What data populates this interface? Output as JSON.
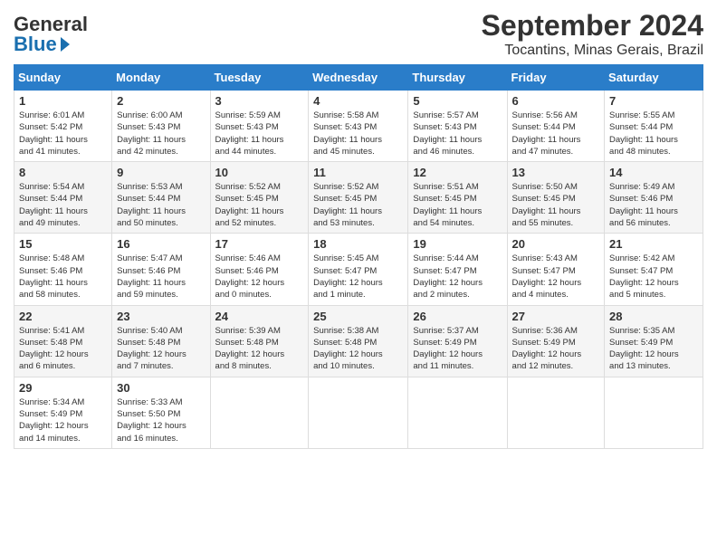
{
  "header": {
    "logo_general": "General",
    "logo_blue": "Blue",
    "month_title": "September 2024",
    "location": "Tocantins, Minas Gerais, Brazil"
  },
  "columns": [
    "Sunday",
    "Monday",
    "Tuesday",
    "Wednesday",
    "Thursday",
    "Friday",
    "Saturday"
  ],
  "weeks": [
    [
      {
        "day": "1",
        "info": "Sunrise: 6:01 AM\nSunset: 5:42 PM\nDaylight: 11 hours\nand 41 minutes."
      },
      {
        "day": "2",
        "info": "Sunrise: 6:00 AM\nSunset: 5:43 PM\nDaylight: 11 hours\nand 42 minutes."
      },
      {
        "day": "3",
        "info": "Sunrise: 5:59 AM\nSunset: 5:43 PM\nDaylight: 11 hours\nand 44 minutes."
      },
      {
        "day": "4",
        "info": "Sunrise: 5:58 AM\nSunset: 5:43 PM\nDaylight: 11 hours\nand 45 minutes."
      },
      {
        "day": "5",
        "info": "Sunrise: 5:57 AM\nSunset: 5:43 PM\nDaylight: 11 hours\nand 46 minutes."
      },
      {
        "day": "6",
        "info": "Sunrise: 5:56 AM\nSunset: 5:44 PM\nDaylight: 11 hours\nand 47 minutes."
      },
      {
        "day": "7",
        "info": "Sunrise: 5:55 AM\nSunset: 5:44 PM\nDaylight: 11 hours\nand 48 minutes."
      }
    ],
    [
      {
        "day": "8",
        "info": "Sunrise: 5:54 AM\nSunset: 5:44 PM\nDaylight: 11 hours\nand 49 minutes."
      },
      {
        "day": "9",
        "info": "Sunrise: 5:53 AM\nSunset: 5:44 PM\nDaylight: 11 hours\nand 50 minutes."
      },
      {
        "day": "10",
        "info": "Sunrise: 5:52 AM\nSunset: 5:45 PM\nDaylight: 11 hours\nand 52 minutes."
      },
      {
        "day": "11",
        "info": "Sunrise: 5:52 AM\nSunset: 5:45 PM\nDaylight: 11 hours\nand 53 minutes."
      },
      {
        "day": "12",
        "info": "Sunrise: 5:51 AM\nSunset: 5:45 PM\nDaylight: 11 hours\nand 54 minutes."
      },
      {
        "day": "13",
        "info": "Sunrise: 5:50 AM\nSunset: 5:45 PM\nDaylight: 11 hours\nand 55 minutes."
      },
      {
        "day": "14",
        "info": "Sunrise: 5:49 AM\nSunset: 5:46 PM\nDaylight: 11 hours\nand 56 minutes."
      }
    ],
    [
      {
        "day": "15",
        "info": "Sunrise: 5:48 AM\nSunset: 5:46 PM\nDaylight: 11 hours\nand 58 minutes."
      },
      {
        "day": "16",
        "info": "Sunrise: 5:47 AM\nSunset: 5:46 PM\nDaylight: 11 hours\nand 59 minutes."
      },
      {
        "day": "17",
        "info": "Sunrise: 5:46 AM\nSunset: 5:46 PM\nDaylight: 12 hours\nand 0 minutes."
      },
      {
        "day": "18",
        "info": "Sunrise: 5:45 AM\nSunset: 5:47 PM\nDaylight: 12 hours\nand 1 minute."
      },
      {
        "day": "19",
        "info": "Sunrise: 5:44 AM\nSunset: 5:47 PM\nDaylight: 12 hours\nand 2 minutes."
      },
      {
        "day": "20",
        "info": "Sunrise: 5:43 AM\nSunset: 5:47 PM\nDaylight: 12 hours\nand 4 minutes."
      },
      {
        "day": "21",
        "info": "Sunrise: 5:42 AM\nSunset: 5:47 PM\nDaylight: 12 hours\nand 5 minutes."
      }
    ],
    [
      {
        "day": "22",
        "info": "Sunrise: 5:41 AM\nSunset: 5:48 PM\nDaylight: 12 hours\nand 6 minutes."
      },
      {
        "day": "23",
        "info": "Sunrise: 5:40 AM\nSunset: 5:48 PM\nDaylight: 12 hours\nand 7 minutes."
      },
      {
        "day": "24",
        "info": "Sunrise: 5:39 AM\nSunset: 5:48 PM\nDaylight: 12 hours\nand 8 minutes."
      },
      {
        "day": "25",
        "info": "Sunrise: 5:38 AM\nSunset: 5:48 PM\nDaylight: 12 hours\nand 10 minutes."
      },
      {
        "day": "26",
        "info": "Sunrise: 5:37 AM\nSunset: 5:49 PM\nDaylight: 12 hours\nand 11 minutes."
      },
      {
        "day": "27",
        "info": "Sunrise: 5:36 AM\nSunset: 5:49 PM\nDaylight: 12 hours\nand 12 minutes."
      },
      {
        "day": "28",
        "info": "Sunrise: 5:35 AM\nSunset: 5:49 PM\nDaylight: 12 hours\nand 13 minutes."
      }
    ],
    [
      {
        "day": "29",
        "info": "Sunrise: 5:34 AM\nSunset: 5:49 PM\nDaylight: 12 hours\nand 14 minutes."
      },
      {
        "day": "30",
        "info": "Sunrise: 5:33 AM\nSunset: 5:50 PM\nDaylight: 12 hours\nand 16 minutes."
      },
      {
        "day": "",
        "info": ""
      },
      {
        "day": "",
        "info": ""
      },
      {
        "day": "",
        "info": ""
      },
      {
        "day": "",
        "info": ""
      },
      {
        "day": "",
        "info": ""
      }
    ]
  ]
}
